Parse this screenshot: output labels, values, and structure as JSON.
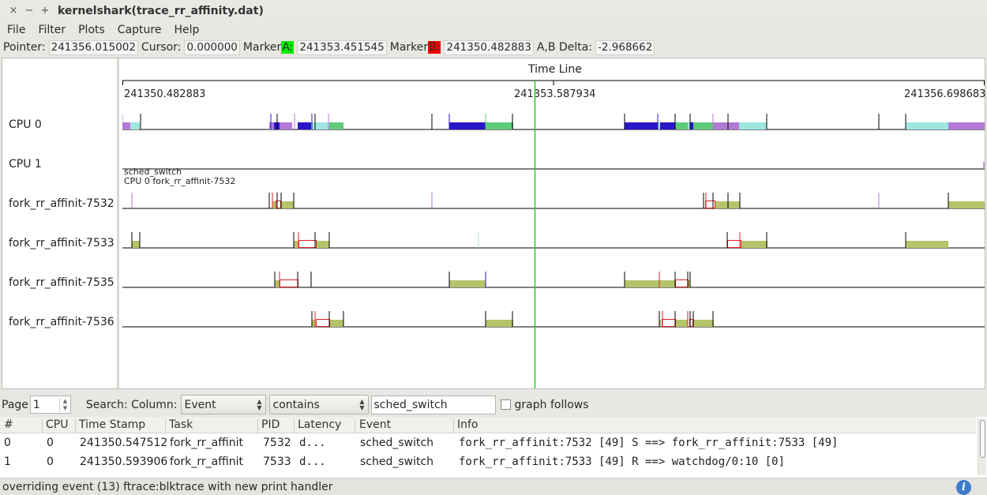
{
  "window": {
    "title": "kernelshark(trace_rr_affinity.dat)",
    "close_glyph": "×",
    "minimize_glyph": "−",
    "maximize_glyph": "+"
  },
  "menu": [
    "File",
    "Filter",
    "Plots",
    "Capture",
    "Help"
  ],
  "info_bar": {
    "pointer_label": "Pointer:",
    "pointer_value": "241356.015002",
    "cursor_label": "Cursor:",
    "cursor_value": "0.000000",
    "marker_a_prefix": "Marker",
    "marker_a_letter": "A:",
    "marker_a_value": "241353.451545",
    "marker_b_prefix": "Marker",
    "marker_b_letter": "B:",
    "marker_b_value": "241350.482883",
    "delta_label": "A,B Delta:",
    "delta_value": "-2.968662",
    "marker_a_color": "#00ee00",
    "marker_b_color": "#ee0000"
  },
  "plot": {
    "timeline_title": "Time Line",
    "tick_labels": [
      "241350.482883",
      "241353.587934",
      "241356.698683"
    ],
    "rows": [
      "CPU 0",
      "CPU 1",
      "fork_rr_affinit-7532",
      "fork_rr_affinit-7533",
      "fork_rr_affinit-7535",
      "fork_rr_affinit-7536"
    ],
    "tooltip_line1": "sched_switch",
    "tooltip_line2": "CPU 0 fork_rr_affinit-7532",
    "marker_a_line_color": "#22cc22",
    "colors": {
      "purple": "#b27ad6",
      "indigo": "#2a16c9",
      "cyan": "#9ee6e0",
      "green": "#5fca7a",
      "olive": "#b5c46a",
      "latency": "#e02020"
    }
  },
  "controls": {
    "page_label": "Page",
    "page_value": "1",
    "search_label": "Search: Column:",
    "column_value": "Event",
    "match_value": "contains",
    "search_text": "sched_switch",
    "graph_follows_label": "graph follows"
  },
  "table": {
    "headers": [
      "#",
      "CPU",
      "Time Stamp",
      "Task",
      "PID",
      "Latency",
      "Event",
      "Info"
    ],
    "rows": [
      [
        "0",
        "0",
        "241350.547512",
        "fork_rr_affinit",
        "7532",
        "d...",
        "sched_switch",
        "fork_rr_affinit:7532 [49] S ==> fork_rr_affinit:7533 [49]"
      ],
      [
        "1",
        "0",
        "241350.593906",
        "fork_rr_affinit",
        "7533",
        "d...",
        "sched_switch",
        "fork_rr_affinit:7533 [49] R ==> watchdog/0:10 [0]"
      ]
    ]
  },
  "status": {
    "message": "overriding event (13) ftrace:blktrace with new print handler",
    "info_icon": "info-icon"
  }
}
